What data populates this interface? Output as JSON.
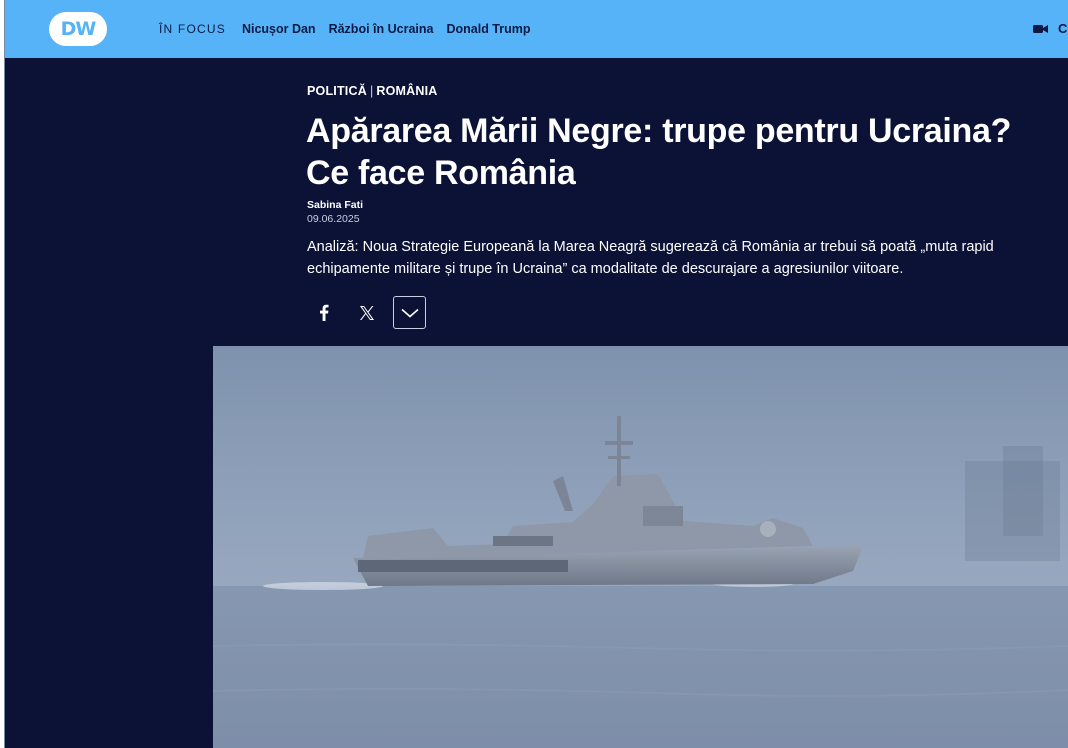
{
  "header": {
    "logo_text": "DW",
    "focus_label": "ÎN FOCUS",
    "links": [
      "Nicușor Dan",
      "Război în Ucraina",
      "Donald Trump"
    ],
    "right_partial_text": "C"
  },
  "article": {
    "kicker": {
      "category": "POLITICĂ",
      "separator": "|",
      "region": "ROMÂNIA"
    },
    "title": "Apărarea Mării Negre: trupe pentru Ucraina? Ce face România",
    "author": "Sabina Fati",
    "date": "09.06.2025",
    "teaser": "Analiză: Noua Strategie Europeană la Marea Neagră sugerează că România ar trebui să poată „muta rapid echipamente militare și trupe în Ucraina” ca modalitate de descurajare a agresiunilor viitoare."
  },
  "share": {
    "icons": [
      "facebook-icon",
      "x-icon",
      "chevron-down-icon"
    ]
  },
  "colors": {
    "topbar": "#56b3f7",
    "article_bg": "#0b1236",
    "nav_text": "#0c1a44"
  }
}
